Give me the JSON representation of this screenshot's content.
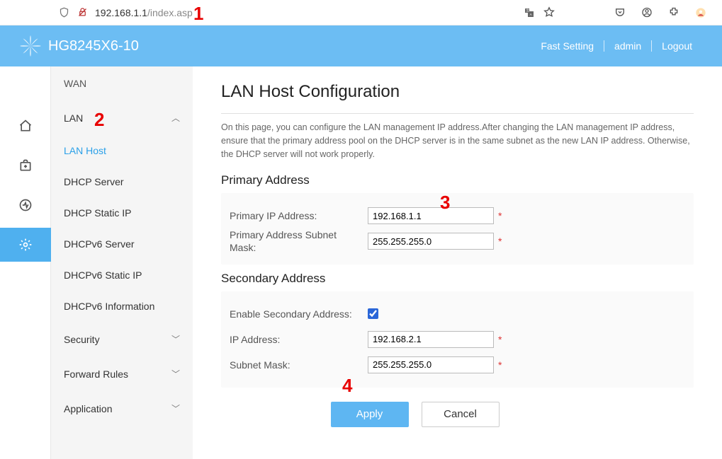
{
  "browser": {
    "host": "192.168.1.1",
    "path": "/index.asp"
  },
  "overlays": {
    "n1": "1",
    "n2": "2",
    "n3": "3",
    "n4": "4"
  },
  "header": {
    "product": "HG8245X6-10",
    "links": {
      "fast": "Fast Setting",
      "user": "admin",
      "logout": "Logout"
    }
  },
  "sidebar": {
    "wan": "WAN",
    "lan": "LAN",
    "lan_items": {
      "lan_host": "LAN Host",
      "dhcp_server": "DHCP Server",
      "dhcp_static_ip": "DHCP Static IP",
      "dhcpv6_server": "DHCPv6 Server",
      "dhcpv6_static_ip": "DHCPv6 Static IP",
      "dhcpv6_info": "DHCPv6 Information"
    },
    "security": "Security",
    "forward_rules": "Forward Rules",
    "application": "Application"
  },
  "page": {
    "title": "LAN Host Configuration",
    "help": "On this page, you can configure the LAN management IP address.After changing the LAN management IP address, ensure that the primary address pool on the DHCP server is in the same subnet as the new LAN IP address. Otherwise, the DHCP server will not work properly.",
    "primary": {
      "heading": "Primary Address",
      "ip_label": "Primary IP Address:",
      "ip_value": "192.168.1.1",
      "mask_label": "Primary Address Subnet Mask:",
      "mask_value": "255.255.255.0"
    },
    "secondary": {
      "heading": "Secondary Address",
      "enable_label": "Enable Secondary Address:",
      "enable_checked": true,
      "ip_label": "IP Address:",
      "ip_value": "192.168.2.1",
      "mask_label": "Subnet Mask:",
      "mask_value": "255.255.255.0"
    },
    "buttons": {
      "apply": "Apply",
      "cancel": "Cancel"
    }
  }
}
